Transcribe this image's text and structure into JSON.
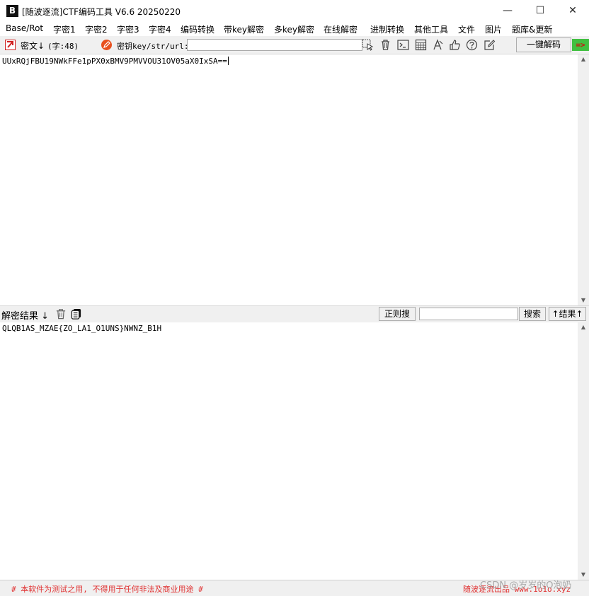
{
  "window": {
    "logo": "B",
    "title": "[随波逐流]CTF编码工具 V6.6 20250220",
    "minimize": "—",
    "maximize": "☐",
    "close": "✕"
  },
  "menu": [
    "Base/Rot",
    "字密1",
    "字密2",
    "字密3",
    "字密4",
    "编码转换",
    "带key解密",
    "多key解密",
    "在线解密",
    "进制转换",
    "其他工具",
    "文件",
    "图片",
    "题库&更新"
  ],
  "toolbar": {
    "cipher_label": "密文↓",
    "char_count": "(字:48)",
    "key_label": "密钥key/str/url:",
    "key_value": "",
    "one_click_decode": "一键解码",
    "arrow": "=>"
  },
  "cipher_text": "UUxRQjFBU19NWkFFe1pPX0xBMV9PMVVOU31OV05aX0IxSA==",
  "result": {
    "label": "解密结果",
    "regex_search": "正则搜",
    "search_value": "",
    "search_button": "搜索",
    "result_up": "↑结果↑",
    "text": "QLQB1AS_MZAE{ZO_LA1_O1UNS}NWNZ_B1H"
  },
  "footer": {
    "disclaimer": "# 本软件为测试之用, 不得用于任何非法及商业用途 #",
    "author": "随波逐流出品 www.1o1o.xyz",
    "watermark": "CSDN @岁岁的O泡奶"
  },
  "colors": {
    "accent_red": "#e03030",
    "arrow_green": "#41c041"
  }
}
